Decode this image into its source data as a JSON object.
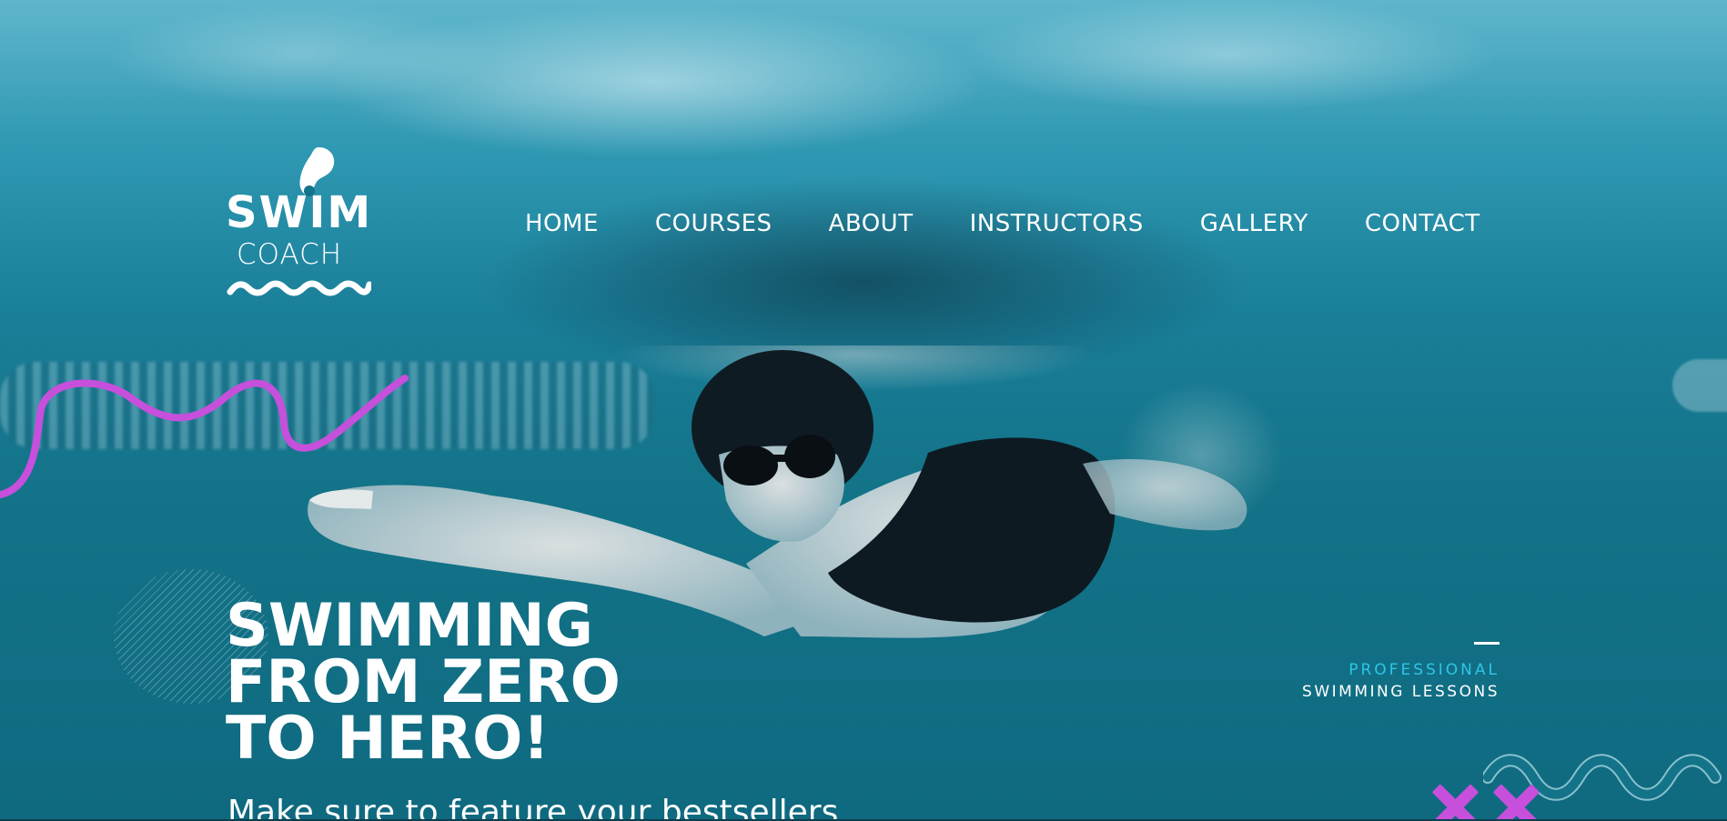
{
  "logo": {
    "primary": "SWIM",
    "secondary": "COACH"
  },
  "nav": {
    "items": [
      {
        "label": "HOME"
      },
      {
        "label": "COURSES"
      },
      {
        "label": "ABOUT"
      },
      {
        "label": "INSTRUCTORS"
      },
      {
        "label": "GALLERY"
      },
      {
        "label": "CONTACT"
      }
    ]
  },
  "hero": {
    "headline_lines": [
      "SWIMMING",
      "FROM ZERO",
      "TO HERO!"
    ],
    "subtext": "Make sure to feature your bestsellers"
  },
  "tagline": {
    "line1": "PROFESSIONAL",
    "line2": "SWIMMING LESSONS"
  },
  "colors": {
    "accent_purple": "#c64fdc",
    "accent_cyan": "#2ec6e8",
    "water": "#137388",
    "text": "#ffffff"
  },
  "icons": {
    "logo_drop": "water-drop-icon",
    "logo_wave": "wave-icon"
  }
}
